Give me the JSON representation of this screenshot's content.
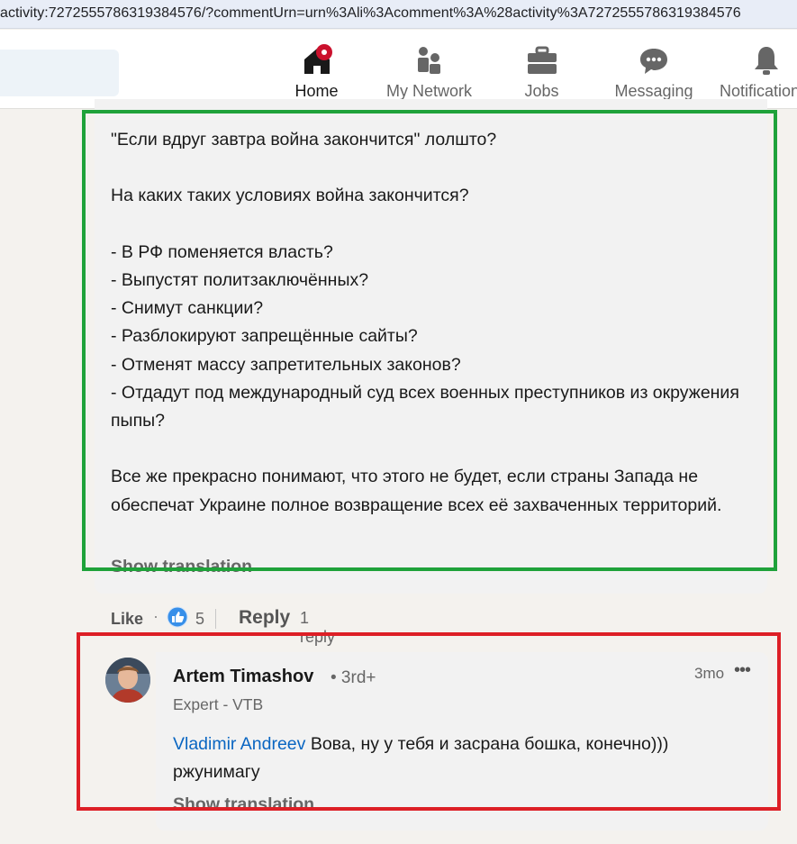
{
  "url": "activity:7272555786319384576/?commentUrn=urn%3Ali%3Acomment%3A%28activity%3A7272555786319384576",
  "nav": {
    "items": [
      {
        "label": "Home",
        "icon": "home-icon",
        "active": true,
        "badge": true
      },
      {
        "label": "My Network",
        "icon": "network-icon"
      },
      {
        "label": "Jobs",
        "icon": "briefcase-icon"
      },
      {
        "label": "Messaging",
        "icon": "chat-icon"
      },
      {
        "label": "Notifications",
        "icon": "bell-icon"
      }
    ]
  },
  "comment": {
    "text": "\"Если вдруг завтра война закончится\" лолшто?\n\nНа каких таких условиях война закончится?\n\n- В РФ поменяется власть?\n- Выпустят политзаключённых?\n- Снимут санкции?\n- Разблокируют запрещённые сайты?\n- Отменят массу запретительных законов?\n- Отдадут под международный суд всех военных преступников из окружения пыпы?\n\nВсе же прекрасно понимают, что этого не будет, если страны Запада не обеспечат Украине полное возвращение всех её захваченных территорий.",
    "show_translation": "Show translation",
    "actions": {
      "like": "Like",
      "dot": "·",
      "reactions": "5",
      "reply": "Reply",
      "replies": "1 reply"
    }
  },
  "reply": {
    "author": "Artem Timashov",
    "degree": "• 3rd+",
    "headline": "Expert - VTB",
    "time": "3mo",
    "more": "•••",
    "mention": "Vladimir Andreev",
    "text": " Вова, ну у тебя и засрана бошка, конечно))) ржунимагу",
    "show_translation": "Show translation"
  },
  "colors": {
    "highlight_green": "#1fa23a",
    "highlight_red": "#dd1f26",
    "link_blue": "#0a66c2"
  }
}
